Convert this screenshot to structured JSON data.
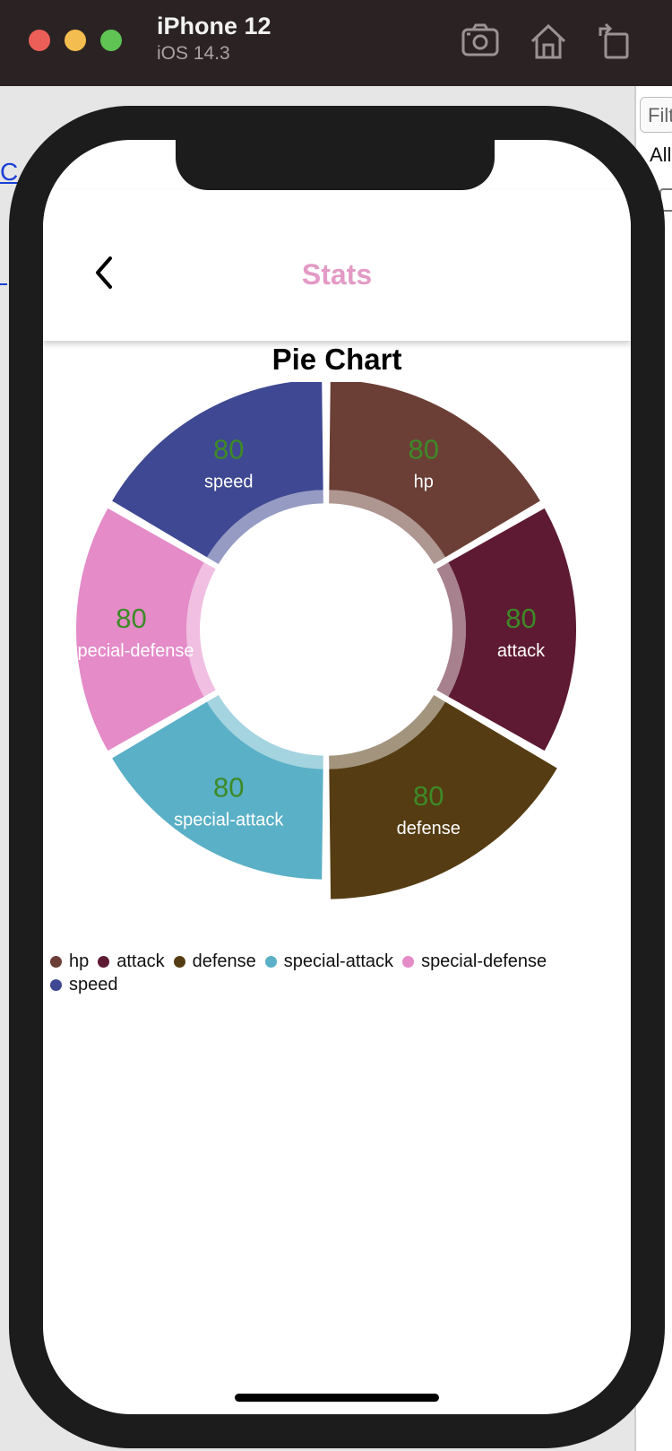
{
  "simulator": {
    "device_name": "iPhone 12",
    "os_version": "iOS 14.3",
    "icons": [
      "screenshot-icon",
      "home-icon",
      "rotate-icon"
    ]
  },
  "background_page": {
    "filter_placeholder": "Filt",
    "all_label": "All",
    "link_text": "C"
  },
  "app": {
    "header": {
      "title": "Stats",
      "title_color": "#e39ac6",
      "back_icon": "chevron-left-icon"
    },
    "chart_data": {
      "type": "pie",
      "title": "Pie Chart",
      "style": "donut",
      "slices": [
        {
          "label": "hp",
          "value": 80,
          "color": "#6b3f36"
        },
        {
          "label": "attack",
          "value": 80,
          "color": "#5e1a32"
        },
        {
          "label": "defense",
          "value": 80,
          "color": "#553c12"
        },
        {
          "label": "special-attack",
          "value": 80,
          "color": "#5ab0c6"
        },
        {
          "label": "special-defense",
          "value": 80,
          "color": "#e48bc8"
        },
        {
          "label": "speed",
          "value": 80,
          "color": "#3f4892"
        }
      ],
      "value_label_color": "#3d8a27",
      "legend_position": "bottom",
      "highlighted_slice": "defense"
    }
  }
}
